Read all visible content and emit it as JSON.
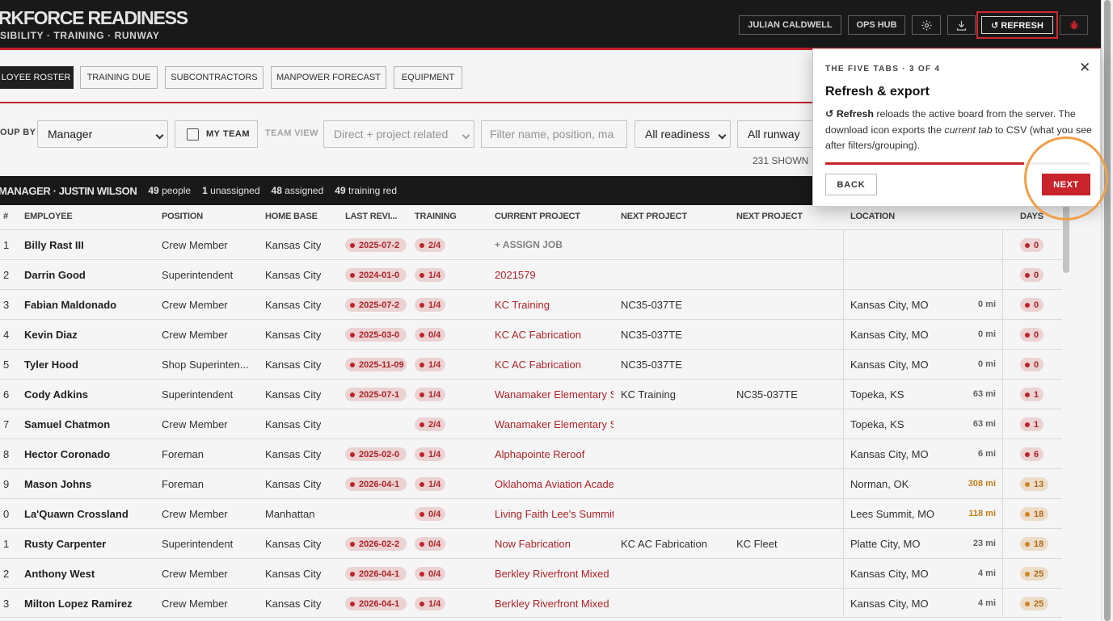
{
  "header": {
    "title": "RKFORCE READINESS",
    "subtitle": "SIBILITY · TRAINING · RUNWAY",
    "user_label": "JULIAN CALDWELL",
    "ops_hub_label": "OPS HUB",
    "refresh_label": "↺ REFRESH",
    "settings_icon": "gear-icon",
    "download_icon": "download-icon",
    "bug_icon": "bug-icon"
  },
  "tabs": [
    {
      "label": "LOYEE ROSTER",
      "active": true
    },
    {
      "label": "TRAINING DUE",
      "active": false
    },
    {
      "label": "SUBCONTRACTORS",
      "active": false
    },
    {
      "label": "MANPOWER FORECAST",
      "active": false
    },
    {
      "label": "EQUIPMENT",
      "active": false
    }
  ],
  "filters": {
    "group_by_label": "OUP BY",
    "group_by_value": "Manager",
    "my_team_label": "MY TEAM",
    "team_view_label": "TEAM VIEW",
    "team_view_value": "Direct + project related",
    "search_placeholder": "Filter name, position, ma",
    "readiness_value": "All readiness",
    "runway_value": "All runway",
    "shown_text": "231 SHOWN ·"
  },
  "group": {
    "title": "MANAGER · JUSTIN WILSON",
    "stats": [
      {
        "count": "49",
        "label": "people"
      },
      {
        "count": "1",
        "label": "unassigned"
      },
      {
        "count": "48",
        "label": "assigned"
      },
      {
        "count": "49",
        "label": "training red"
      }
    ]
  },
  "columns": [
    "#",
    "EMPLOYEE",
    "POSITION",
    "HOME BASE",
    "LAST REVI...",
    "TRAINING",
    "CURRENT PROJECT",
    "NEXT PROJECT",
    "NEXT PROJECT",
    "LOCATION",
    "DAYS"
  ],
  "rows": [
    {
      "num": "1",
      "employee": "Billy Rast III",
      "position": "Crew Member",
      "home": "Kansas City",
      "review": "2025-07-2",
      "training": "2/4",
      "project": "+ ASSIGN JOB",
      "assign": true,
      "next1": "",
      "next2": "",
      "location": "",
      "miles": "",
      "miles_color": "",
      "days": "0",
      "days_amber": false
    },
    {
      "num": "2",
      "employee": "Darrin Good",
      "position": "Superintendent",
      "home": "Kansas City",
      "review": "2024-01-0",
      "training": "1/4",
      "project": "2021579",
      "assign": false,
      "next1": "",
      "next2": "",
      "location": "",
      "miles": "",
      "miles_color": "",
      "days": "0",
      "days_amber": false
    },
    {
      "num": "3",
      "employee": "Fabian Maldonado",
      "position": "Crew Member",
      "home": "Kansas City",
      "review": "2025-07-2",
      "training": "1/4",
      "project": "KC Training",
      "assign": false,
      "next1": "NC35-037TE",
      "next2": "",
      "location": "Kansas City, MO",
      "miles": "0 mi",
      "miles_color": "#666",
      "days": "0",
      "days_amber": false
    },
    {
      "num": "4",
      "employee": "Kevin Diaz",
      "position": "Crew Member",
      "home": "Kansas City",
      "review": "2025-03-0",
      "training": "0/4",
      "project": "KC AC Fabrication",
      "assign": false,
      "next1": "NC35-037TE",
      "next2": "",
      "location": "Kansas City, MO",
      "miles": "0 mi",
      "miles_color": "#666",
      "days": "0",
      "days_amber": false
    },
    {
      "num": "5",
      "employee": "Tyler Hood",
      "position": "Shop Superinten...",
      "home": "Kansas City",
      "review": "2025-11-09",
      "training": "1/4",
      "project": "KC AC Fabrication",
      "assign": false,
      "next1": "NC35-037TE",
      "next2": "",
      "location": "Kansas City, MO",
      "miles": "0 mi",
      "miles_color": "#666",
      "days": "0",
      "days_amber": false
    },
    {
      "num": "6",
      "employee": "Cody Adkins",
      "position": "Superintendent",
      "home": "Kansas City",
      "review": "2025-07-1",
      "training": "1/4",
      "project": "Wanamaker Elementary S",
      "assign": false,
      "next1": "KC Training",
      "next2": "NC35-037TE",
      "location": "Topeka, KS",
      "miles": "63 mi",
      "miles_color": "#666",
      "days": "1",
      "days_amber": false
    },
    {
      "num": "7",
      "employee": "Samuel Chatmon",
      "position": "Crew Member",
      "home": "Kansas City",
      "review": "",
      "training": "2/4",
      "project": "Wanamaker Elementary S",
      "assign": false,
      "next1": "",
      "next2": "",
      "location": "Topeka, KS",
      "miles": "63 mi",
      "miles_color": "#666",
      "days": "1",
      "days_amber": false
    },
    {
      "num": "8",
      "employee": "Hector Coronado",
      "position": "Foreman",
      "home": "Kansas City",
      "review": "2025-02-0",
      "training": "1/4",
      "project": "Alphapointe Reroof",
      "assign": false,
      "next1": "",
      "next2": "",
      "location": "Kansas City, MO",
      "miles": "6 mi",
      "miles_color": "#666",
      "days": "6",
      "days_amber": false
    },
    {
      "num": "9",
      "employee": "Mason Johns",
      "position": "Foreman",
      "home": "Kansas City",
      "review": "2026-04-1",
      "training": "1/4",
      "project": "Oklahoma Aviation Acade",
      "assign": false,
      "next1": "",
      "next2": "",
      "location": "Norman, OK",
      "miles": "308 mi",
      "miles_color": "#c8821e",
      "days": "13",
      "days_amber": true
    },
    {
      "num": "0",
      "employee": "La'Quawn Crossland",
      "position": "Crew Member",
      "home": "Manhattan",
      "review": "",
      "training": "0/4",
      "project": "Living Faith Lee's Summit",
      "assign": false,
      "next1": "",
      "next2": "",
      "location": "Lees Summit, MO",
      "miles": "118 mi",
      "miles_color": "#c8821e",
      "days": "18",
      "days_amber": true
    },
    {
      "num": "1",
      "employee": "Rusty Carpenter",
      "position": "Superintendent",
      "home": "Kansas City",
      "review": "2026-02-2",
      "training": "0/4",
      "project": "Now Fabrication",
      "assign": false,
      "next1": "KC AC Fabrication",
      "next2": "KC Fleet",
      "location": "Platte City, MO",
      "miles": "23 mi",
      "miles_color": "#666",
      "days": "18",
      "days_amber": true
    },
    {
      "num": "2",
      "employee": "Anthony West",
      "position": "Crew Member",
      "home": "Kansas City",
      "review": "2026-04-1",
      "training": "0/4",
      "project": "Berkley Riverfront Mixed",
      "assign": false,
      "next1": "",
      "next2": "",
      "location": "Kansas City, MO",
      "miles": "4 mi",
      "miles_color": "#666",
      "days": "25",
      "days_amber": true
    },
    {
      "num": "3",
      "employee": "Milton Lopez Ramirez",
      "position": "Crew Member",
      "home": "Kansas City",
      "review": "2026-04-1",
      "training": "1/4",
      "project": "Berkley Riverfront Mixed",
      "assign": false,
      "next1": "",
      "next2": "",
      "location": "Kansas City, MO",
      "miles": "4 mi",
      "miles_color": "#666",
      "days": "25",
      "days_amber": true
    }
  ],
  "popover": {
    "kicker": "THE FIVE TABS · 3 OF 4",
    "title": "Refresh & export",
    "body_strong": "↺ Refresh",
    "body_1": " reloads the active board from the server. The download icon exports the ",
    "body_em": "current tab",
    "body_2": " to CSV (what you see after filters/grouping).",
    "back_label": "BACK",
    "next_label": "NEXT",
    "close_icon": "close-icon",
    "step": 3,
    "total_steps": 4,
    "progress_fraction": 0.75
  },
  "colors": {
    "accent": "#c8242c",
    "header_bg": "#1b1b1b",
    "highlight_ring": "#f0a04a"
  }
}
